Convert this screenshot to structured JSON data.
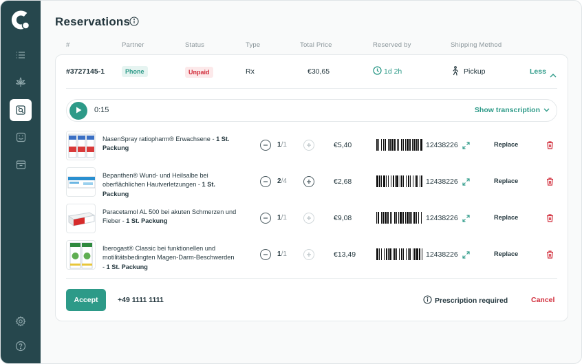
{
  "page": {
    "title": "Reservations"
  },
  "columns": [
    "#",
    "Partner",
    "Status",
    "Type",
    "Total Price",
    "Reserved by",
    "Shipping Method"
  ],
  "reservation": {
    "id": "#3727145-1",
    "partner": "Phone",
    "status": "Unpaid",
    "type": "Rx",
    "total_price": "€30,65",
    "reserved_by": "1d 2h",
    "shipping_method": "Pickup",
    "toggle_label": "Less"
  },
  "audio": {
    "time": "0:15",
    "show_transcription_label": "Show transcription"
  },
  "products": [
    {
      "name": "NasenSpray ratiopharm® Erwachsene - ",
      "pack": "1 St. Packung",
      "qty": "1",
      "qty_total": "/1",
      "price": "€5,40",
      "code": "12438226",
      "replace_label": "Replace",
      "plus_enabled": false,
      "image": "nasal-spray-box"
    },
    {
      "name": "Bepanthen® Wund- und Heilsalbe bei oberflächlichen Hautverletzungen - ",
      "pack": "1 St. Packung",
      "qty": "2",
      "qty_total": "/4",
      "price": "€2,68",
      "code": "12438226",
      "replace_label": "Replace",
      "plus_enabled": true,
      "image": "ointment-box"
    },
    {
      "name": "Paracetamol AL 500 bei akuten Schmerzen und Fieber  - ",
      "pack": "1 St. Packung",
      "qty": "1",
      "qty_total": "/1",
      "price": "€9,08",
      "code": "12438226",
      "replace_label": "Replace",
      "plus_enabled": false,
      "image": "tablet-box"
    },
    {
      "name": "Iberogast® Classic bei funktionellen und motilitätsbedingten Magen-Darm-Beschwerden - ",
      "pack": "1 St. Packung",
      "qty": "1",
      "qty_total": "/1",
      "price": "€13,49",
      "code": "12438226",
      "replace_label": "Replace",
      "plus_enabled": false,
      "image": "herbal-drops-box"
    }
  ],
  "footer": {
    "accept_label": "Accept",
    "phone": "+49 1111 1111",
    "prescription_label": "Prescription required",
    "cancel_label": "Cancel"
  },
  "colors": {
    "sidebar": "#26474d",
    "accent": "#2d9a88",
    "danger": "#d12c3a"
  },
  "sidebar_icons": [
    "list-icon",
    "cannabis-leaf-icon",
    "reservations-icon",
    "chat-icon",
    "archive-icon",
    "settings-icon",
    "help-icon"
  ]
}
